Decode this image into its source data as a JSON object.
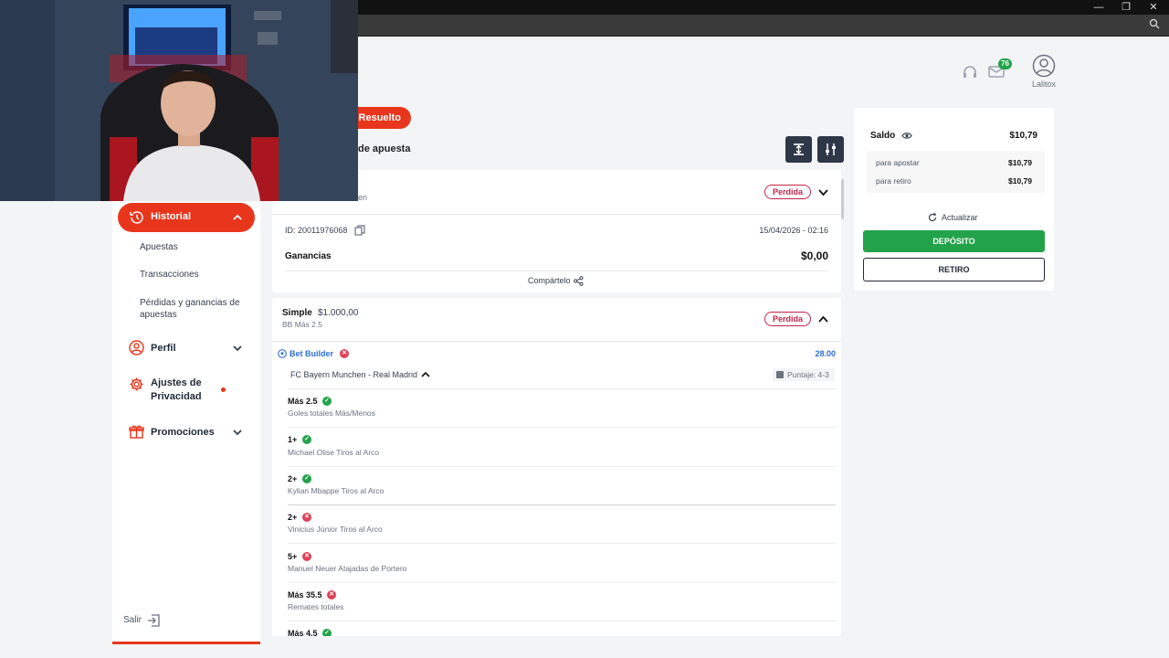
{
  "header": {
    "mail_count": "76",
    "user_name": "Lalitox"
  },
  "filters": {
    "resuelto_label": "Resuelto",
    "tipo_label": "de apuesta"
  },
  "sidebar": {
    "historial_label": "Historial",
    "sub_items": [
      "Apuestas",
      "Transacciones",
      "Pérdidas y ganancias de apuestas"
    ],
    "perfil_label": "Perfil",
    "privacidad_label": "Ajustes de Privacidad",
    "promociones_label": "Promociones",
    "salir_label": "Salir"
  },
  "bet1": {
    "subtitle": "en",
    "status": "Perdida",
    "id_text": "ID: 20011976068",
    "date": "15/04/2026 - 02:16",
    "ganancias_label": "Ganancias",
    "ganancias_value": "$0,00",
    "share_label": "Compártelo"
  },
  "bet2": {
    "type": "Simple",
    "amount": "$1.000,00",
    "subtitle": "BB Más 2.5",
    "status": "Perdida",
    "builder_label": "Bet Builder",
    "odds": "28.00",
    "match": "FC Bayern Munchen - Real Madrid",
    "score": "Puntaje: 4-3",
    "legs": [
      {
        "title": "Más 2.5",
        "sub": "Goles totales Más/Menos",
        "result": "won"
      },
      {
        "title": "1+",
        "sub": "Michael Olise Tiros al Arco",
        "result": "won"
      },
      {
        "title": "2+",
        "sub": "Kylian Mbappe Tiros al Arco",
        "result": "won"
      },
      {
        "title": "2+",
        "sub": "Vinicius Júnior Tiros al Arco",
        "result": "lost"
      },
      {
        "title": "5+",
        "sub": "Manuel Neuer Atajadas de Portero",
        "result": "lost"
      },
      {
        "title": "Más 35.5",
        "sub": "Remates totales",
        "result": "lost"
      },
      {
        "title": "Más 4.5",
        "sub": "",
        "result": "won"
      }
    ]
  },
  "balance": {
    "saldo_label": "Saldo",
    "saldo_value": "$10,79",
    "apostar_label": "para apostar",
    "apostar_value": "$10,79",
    "retiro_label": "para retiro",
    "retiro_value": "$10,79",
    "refresh_label": "Actualizar",
    "deposit_label": "DEPÓSITO",
    "withdraw_label": "RETIRO"
  },
  "colors": {
    "accent": "#e8361c",
    "success": "#22a34a",
    "loss": "#c0264a",
    "link": "#2f6fd6"
  }
}
